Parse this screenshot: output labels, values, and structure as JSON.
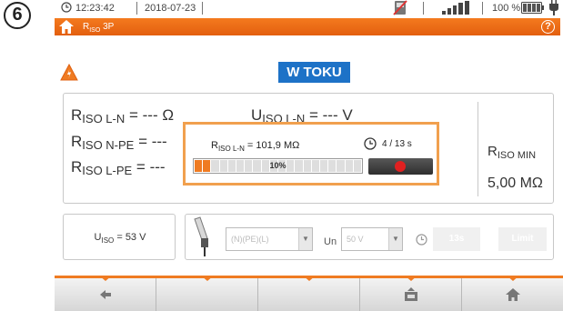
{
  "step": "6",
  "status": {
    "time": "12:23:42",
    "date": "2018-07-23",
    "battery": "100 %"
  },
  "header": {
    "title": "R",
    "title_sub": "ISO",
    "title_suffix": " 3P",
    "help": "?"
  },
  "badge": "W TOKU",
  "measurements": {
    "riso_ln": {
      "sym": "R",
      "sub": "ISO L-N",
      "value": " = --- Ω"
    },
    "uiso_ln": {
      "sym": "U",
      "sub": "ISO L-N",
      "value": " = --- V"
    },
    "riso_npe": {
      "sym": "R",
      "sub": "ISO N-PE",
      "value": " = ---"
    },
    "riso_lpe": {
      "sym": "R",
      "sub": "ISO L-PE",
      "value": " = ---"
    }
  },
  "riso_min": {
    "sym": "R",
    "sub": "ISO MIN",
    "value": "5,00 MΩ"
  },
  "progress_popup": {
    "sym": "R",
    "sub": "ISO L-N",
    "value": " = 101,9 MΩ",
    "time": "4 / 13 s",
    "percent": "10%",
    "progress": 0.1
  },
  "uiso": {
    "sym": "U",
    "sub": "ISO",
    "value": " = 53 V"
  },
  "settings": {
    "mode": "(N)(PE)(L)",
    "un_label": "Un",
    "un_value": "50 V",
    "time_button": "13s",
    "limit_button": "Limit"
  },
  "colors": {
    "accent": "#ef7b22",
    "badge": "#1d72c7",
    "stop": "#e02020"
  }
}
